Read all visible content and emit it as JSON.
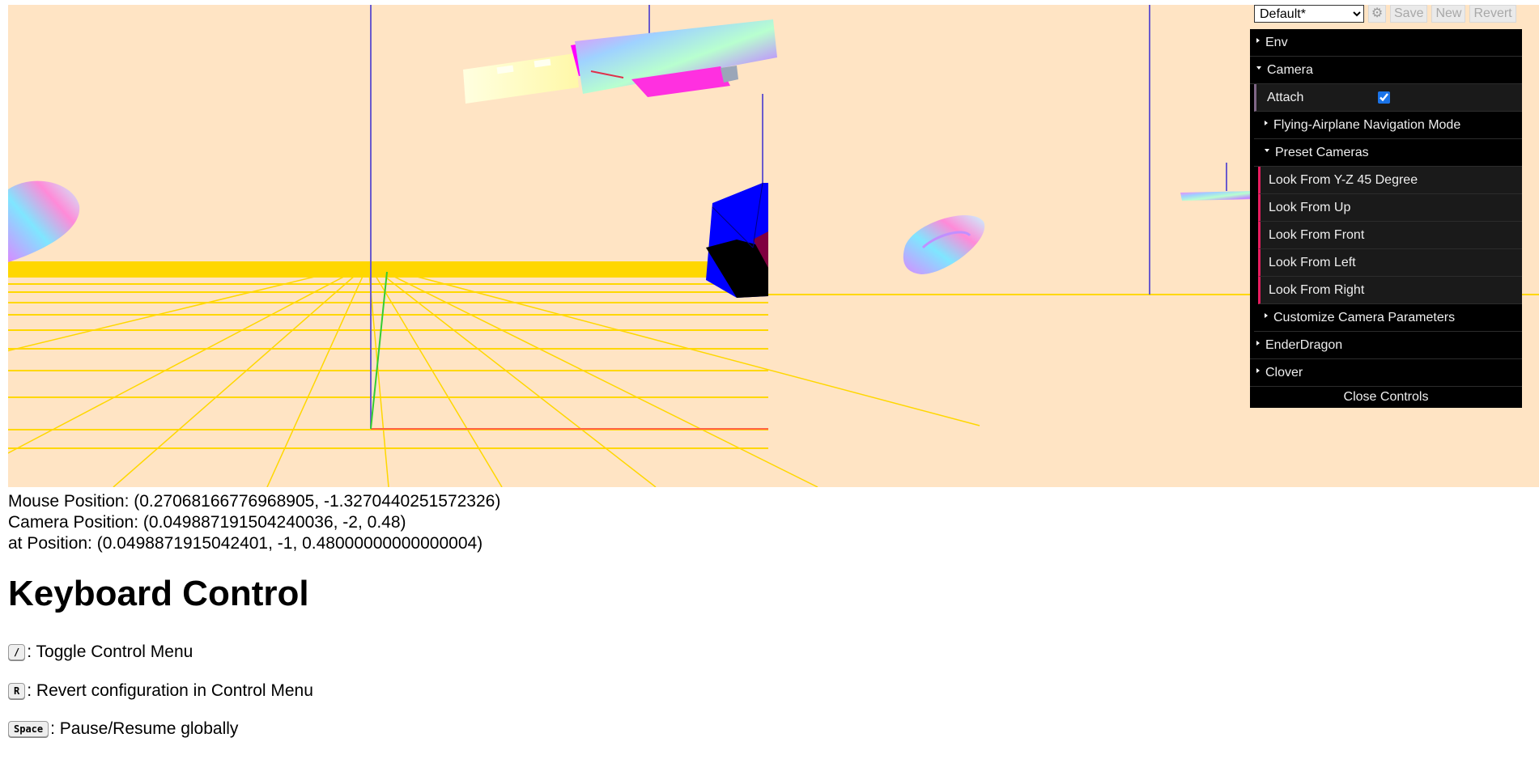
{
  "info": {
    "mouse_position": "Mouse Position: (0.27068166776968905, -1.3270440251572326)",
    "camera_position": "Camera Position: (0.049887191504240036, -2, 0.48)",
    "at_position": "at Position: (0.0498871915042401, -1, 0.48000000000000004)"
  },
  "keyboard": {
    "heading": "Keyboard Control",
    "items": [
      {
        "key": "/",
        "text": ": Toggle Control Menu"
      },
      {
        "key": "R",
        "text": ": Revert configuration in Control Menu"
      },
      {
        "key": "Space",
        "text": ": Pause/Resume globally"
      }
    ]
  },
  "gui": {
    "preset": "Default*",
    "save_label": "Save",
    "new_label": "New",
    "revert_label": "Revert",
    "folders": {
      "env": "Env",
      "camera": "Camera",
      "attach_label": "Attach",
      "attach_checked": true,
      "flying_mode": "Flying-Airplane Navigation Mode",
      "preset_cameras": "Preset Cameras",
      "presets": [
        "Look From Y-Z 45 Degree",
        "Look From Up",
        "Look From Front",
        "Look From Left",
        "Look From Right"
      ],
      "customize": "Customize Camera Parameters",
      "ender_dragon": "EnderDragon",
      "clover": "Clover"
    },
    "close_label": "Close Controls"
  },
  "colors": {
    "canvas_bg": "#ffe4c4",
    "grid": "#ffd700",
    "panel_bg": "#000000",
    "function_accent": "#e61d5f",
    "boolean_accent": "#806787"
  }
}
